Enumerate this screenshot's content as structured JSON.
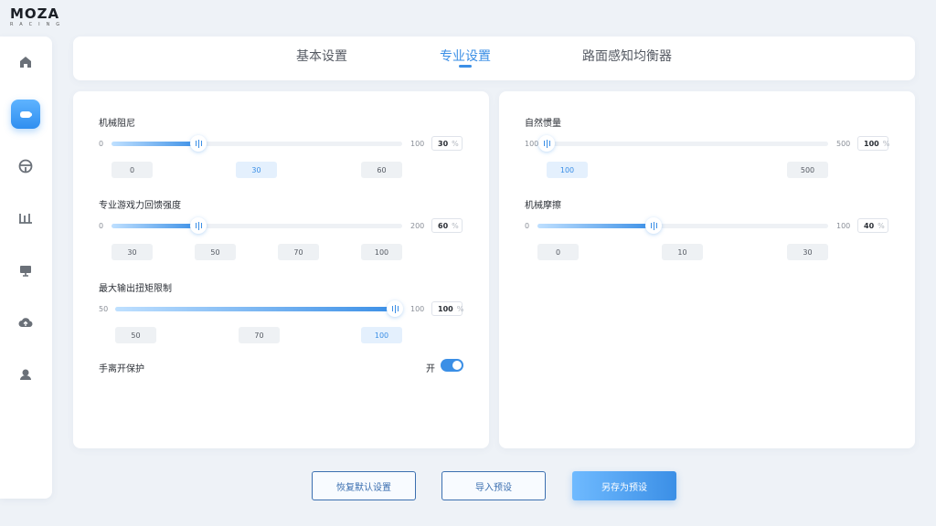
{
  "brand": {
    "name": "MOZA",
    "sub": "RACING"
  },
  "sidebar": {
    "items": [
      {
        "icon": "home-icon"
      },
      {
        "icon": "wheelbase-icon",
        "active": true
      },
      {
        "icon": "steering-wheel-icon"
      },
      {
        "icon": "pedals-icon"
      },
      {
        "icon": "dashboard-icon"
      },
      {
        "icon": "cloud-upload-icon"
      },
      {
        "icon": "user-icon"
      }
    ]
  },
  "tabs": [
    {
      "label": "基本设置"
    },
    {
      "label": "专业设置",
      "active": true
    },
    {
      "label": "路面感知均衡器"
    }
  ],
  "left": {
    "mech_damping": {
      "label": "机械阻尼",
      "min": "0",
      "max": "100",
      "value": "30",
      "unit": "%",
      "fraction": 0.3,
      "presets": [
        "0",
        "30",
        "60"
      ],
      "selected": "30"
    },
    "game_ffb": {
      "label": "专业游戏力回馈强度",
      "min": "0",
      "max": "200",
      "value": "60",
      "unit": "%",
      "fraction": 0.3,
      "presets": [
        "30",
        "50",
        "70",
        "100"
      ]
    },
    "max_torque": {
      "label": "最大输出扭矩限制",
      "min": "50",
      "max": "100",
      "value": "100",
      "unit": "%",
      "fraction": 1.0,
      "presets": [
        "50",
        "70",
        "100"
      ],
      "selected": "100"
    },
    "hands_off": {
      "label": "手离开保护",
      "state": "开",
      "on": true
    }
  },
  "right": {
    "natural_inertia": {
      "label": "自然惯量",
      "min": "100",
      "max": "500",
      "value": "100",
      "unit": "%",
      "fraction": 0.0,
      "presets": [
        "100",
        "500"
      ],
      "selected": "100"
    },
    "mech_friction": {
      "label": "机械摩擦",
      "min": "0",
      "max": "100",
      "value": "40",
      "unit": "%",
      "fraction": 0.4,
      "presets": [
        "0",
        "10",
        "30"
      ]
    }
  },
  "buttons": {
    "restore": "恢复默认设置",
    "import": "导入预设",
    "save_as": "另存为预设"
  },
  "colors": {
    "accent": "#3b8fe6",
    "background": "#eef2f7",
    "panel": "#ffffff"
  }
}
